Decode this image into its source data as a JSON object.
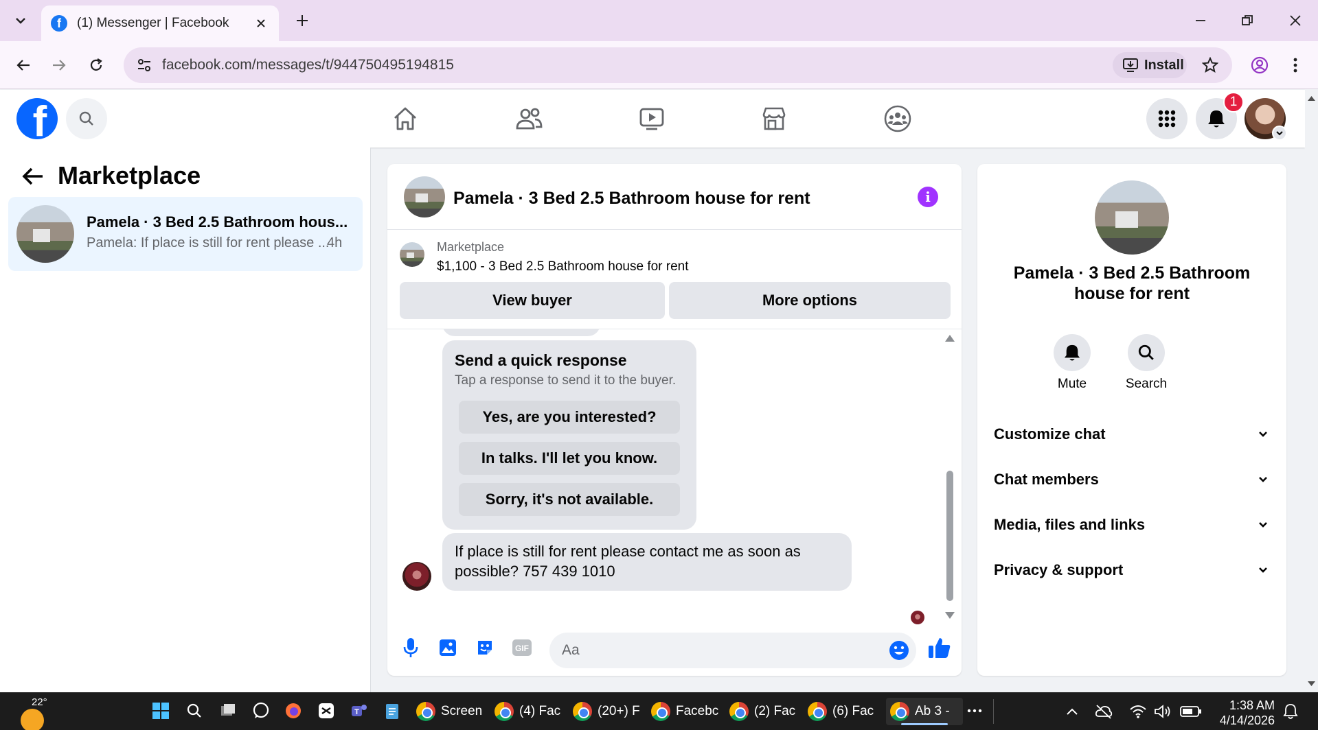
{
  "browser": {
    "tab_title": "(1) Messenger | Facebook",
    "url": "facebook.com/messages/t/944750495194815",
    "install_label": "Install"
  },
  "fb_header": {
    "notification_count": "1"
  },
  "sidebar": {
    "title": "Marketplace",
    "conversations": [
      {
        "name": "Pamela · 3 Bed 2.5 Bathroom hous...",
        "snippet": "Pamela: If place is still for rent please ...",
        "time": "4h"
      }
    ]
  },
  "chat": {
    "title": "Pamela · 3 Bed 2.5 Bathroom house for rent",
    "marketplace_label": "Marketplace",
    "listing": "$1,100 - 3 Bed 2.5 Bathroom house for rent",
    "view_buyer": "View buyer",
    "more_options": "More options",
    "quick_title": "Send a quick response",
    "quick_sub": "Tap a response to send it to the buyer.",
    "quick_options": [
      "Yes, are you interested?",
      "In talks. I'll let you know.",
      "Sorry, it's not available."
    ],
    "message_line1": "If place is still for rent please contact me as soon as",
    "message_line2": "possible? 757 439 1010",
    "composer_placeholder": "Aa"
  },
  "info_panel": {
    "name_line1": "Pamela · 3 Bed 2.5 Bathroom",
    "name_line2": "house for rent",
    "mute": "Mute",
    "search": "Search",
    "rows": [
      "Customize chat",
      "Chat members",
      "Media, files and links",
      "Privacy & support"
    ]
  },
  "taskbar": {
    "temperature": "22°",
    "apps": [
      "Screen",
      "(4) Fac",
      "(20+) F",
      "Facebc",
      "(2) Fac",
      "(6) Fac",
      "Ab 3 -"
    ],
    "time": "1:38 AM",
    "date": "4/14/2026"
  },
  "colors": {
    "fb_blue": "#0866ff",
    "accent_purple": "#a033ff",
    "badge_red": "#e41e3f"
  }
}
